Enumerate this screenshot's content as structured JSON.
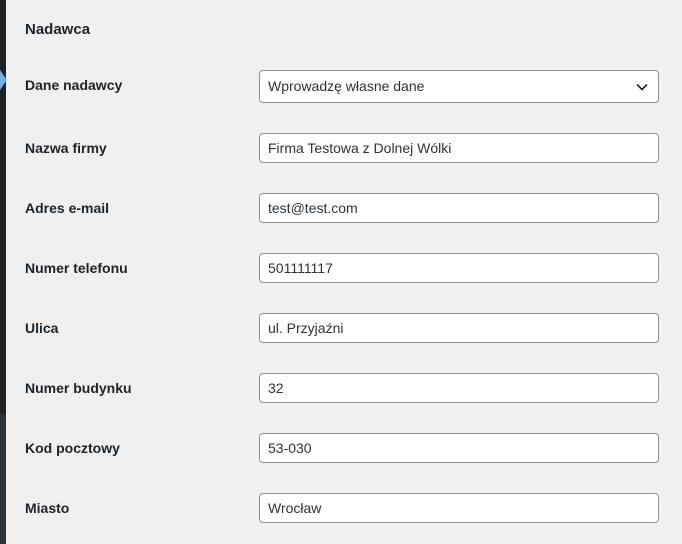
{
  "section": {
    "title": "Nadawca"
  },
  "sender_source": {
    "label": "Dane nadawcy",
    "selected": "Wprowadzę własne dane"
  },
  "fields": {
    "company": {
      "label": "Nazwa firmy",
      "value": "Firma Testowa z Dolnej Wólki"
    },
    "email": {
      "label": "Adres e-mail",
      "value": "test@test.com"
    },
    "phone": {
      "label": "Numer telefonu",
      "value": "501111117"
    },
    "street": {
      "label": "Ulica",
      "value": "ul. Przyjaźni"
    },
    "building": {
      "label": "Numer budynku",
      "value": "32"
    },
    "postcode": {
      "label": "Kod pocztowy",
      "value": "53-030"
    },
    "city": {
      "label": "Miasto",
      "value": "Wrocław"
    }
  },
  "icons": {
    "select_chevron": "chevron-down-icon",
    "menu_pointer": "menu-arrow-icon"
  },
  "colors": {
    "background": "#f0f0f1",
    "sidebar": "#1d2327",
    "field_border": "#8c8f94",
    "text": "#1d2327",
    "accent": "#72aee6"
  }
}
